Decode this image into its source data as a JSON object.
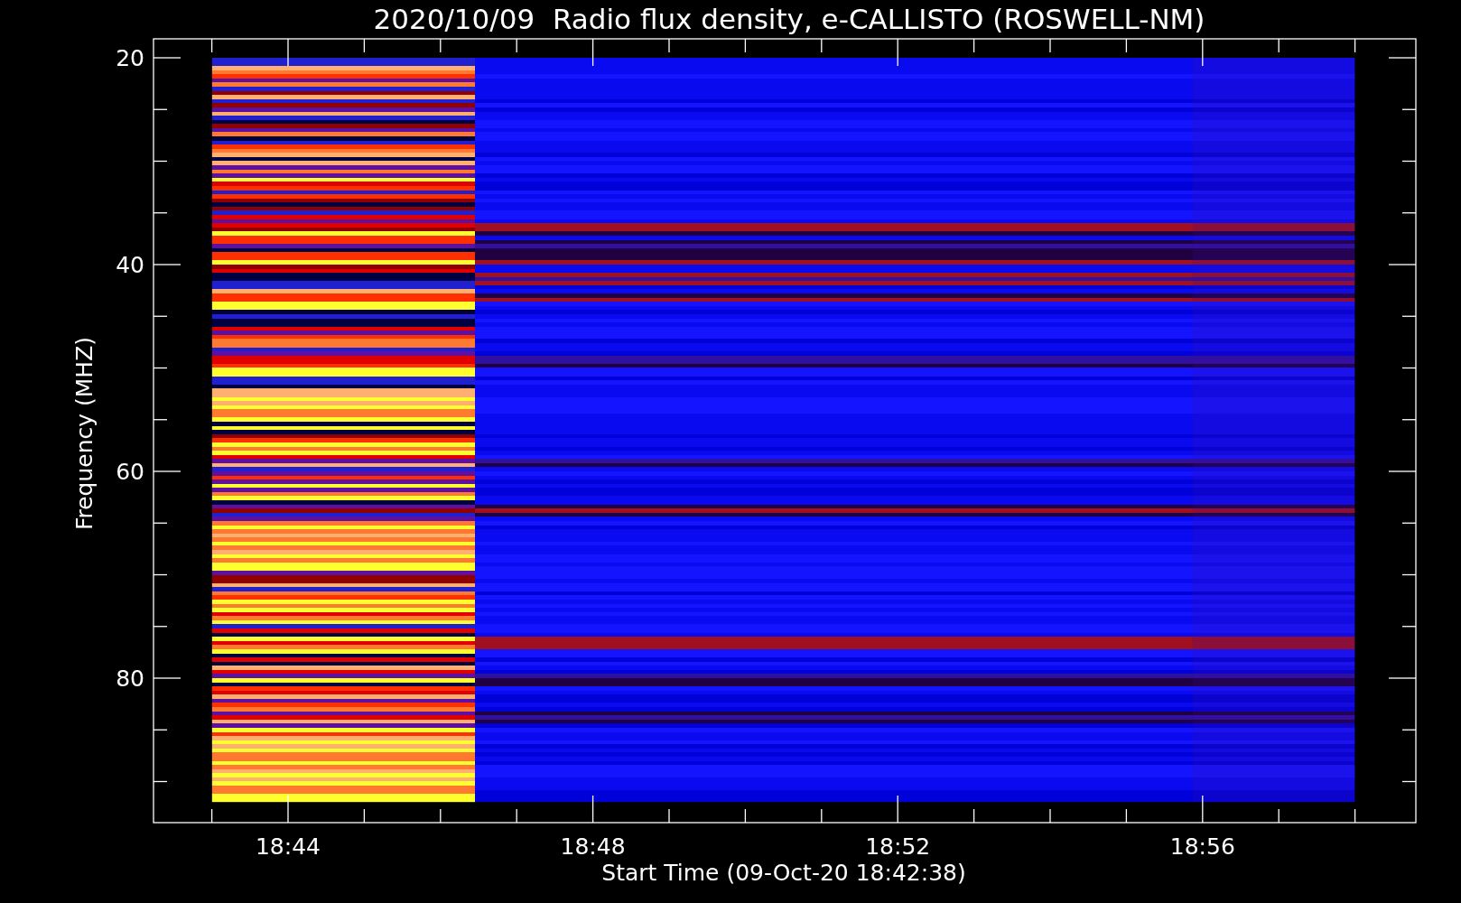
{
  "title": "2020/10/09  Radio flux density, e-CALLISTO (ROSWELL-NM)",
  "y_axis": {
    "label": "Frequency (MHZ)",
    "ticks": [
      "20",
      "40",
      "60",
      "80"
    ]
  },
  "x_axis": {
    "label": "Start Time (09-Oct-20 18:42:38)",
    "ticks": [
      "18:44",
      "18:48",
      "18:52",
      "18:56"
    ]
  }
}
